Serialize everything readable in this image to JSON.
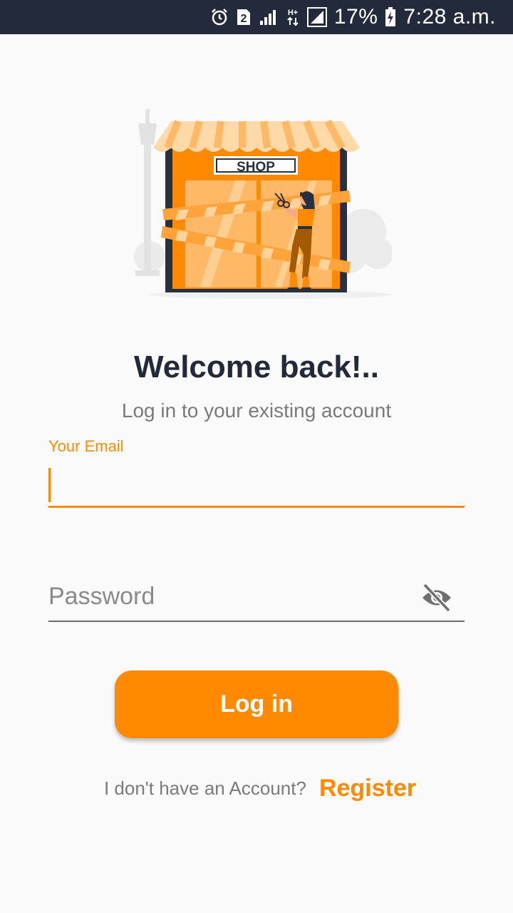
{
  "status_bar": {
    "battery_percent": "17%",
    "time": "7:28 a.m.",
    "sim_slot": "2",
    "network_type": "H+",
    "icons": [
      "alarm-icon",
      "sim-2-icon",
      "signal-icon",
      "data-hplus-icon",
      "signal-icon",
      "battery-charging-icon"
    ]
  },
  "illustration": {
    "shop_sign": "SHOP",
    "colors": {
      "accent": "#ff8a00",
      "awning_light": "#ffd9a8",
      "frame_dark": "#26303f"
    }
  },
  "login": {
    "title": "Welcome back!..",
    "subtitle": "Log in to your existing account",
    "email_label": "Your Email",
    "email_value": "",
    "password_placeholder": "Password",
    "password_visibility_icon": "visibility-off-icon",
    "login_button_label": "Log in",
    "no_account_text": "I don't have an Account?",
    "register_link_label": "Register"
  },
  "colors": {
    "accent": "#ff8a00",
    "status_bar_bg": "#232a3b",
    "background": "#fafafa",
    "title_text": "#222a3a",
    "muted_text": "#7a7a7a"
  }
}
